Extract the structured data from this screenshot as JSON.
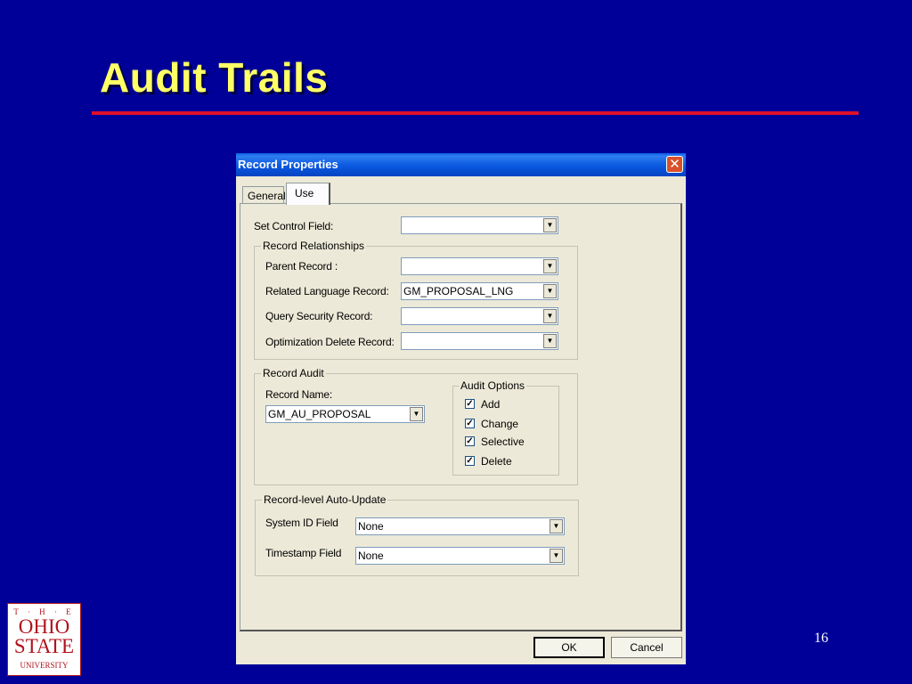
{
  "slide": {
    "title": "Audit Trails",
    "page_number": "16",
    "rule_color": "#e0102a",
    "title_color": "#ffff66",
    "background": "#000099"
  },
  "dialog": {
    "title": "Record Properties",
    "close_icon": "close-icon",
    "tabs": [
      {
        "label": "General",
        "active": false
      },
      {
        "label": "Use",
        "active": true
      }
    ],
    "set_control_field": {
      "label": "Set Control Field:",
      "value": ""
    },
    "record_relationships": {
      "legend": "Record Relationships",
      "parent_record": {
        "label": "Parent Record :",
        "value": ""
      },
      "related_language_record": {
        "label": "Related Language Record:",
        "value": "GM_PROPOSAL_LNG"
      },
      "query_security_record": {
        "label": "Query Security Record:",
        "value": ""
      },
      "optimization_delete_record": {
        "label": "Optimization Delete Record:",
        "value": ""
      }
    },
    "record_audit": {
      "legend": "Record Audit",
      "record_name_label": "Record Name:",
      "record_name_value": "GM_AU_PROPOSAL",
      "audit_options": {
        "legend": "Audit Options",
        "options": [
          {
            "label": "Add",
            "checked": true
          },
          {
            "label": "Change",
            "checked": true
          },
          {
            "label": "Selective",
            "checked": true
          },
          {
            "label": "Delete",
            "checked": true
          }
        ]
      }
    },
    "auto_update": {
      "legend": "Record-level Auto-Update",
      "system_id_field": {
        "label": "System ID Field",
        "value": "None"
      },
      "timestamp_field": {
        "label": "Timestamp Field",
        "value": "None"
      }
    },
    "buttons": {
      "ok": "OK",
      "cancel": "Cancel"
    }
  },
  "logo": {
    "the": "T · H · E",
    "ohio": "OHIO",
    "state": "STATE",
    "university": "UNIVERSITY"
  }
}
